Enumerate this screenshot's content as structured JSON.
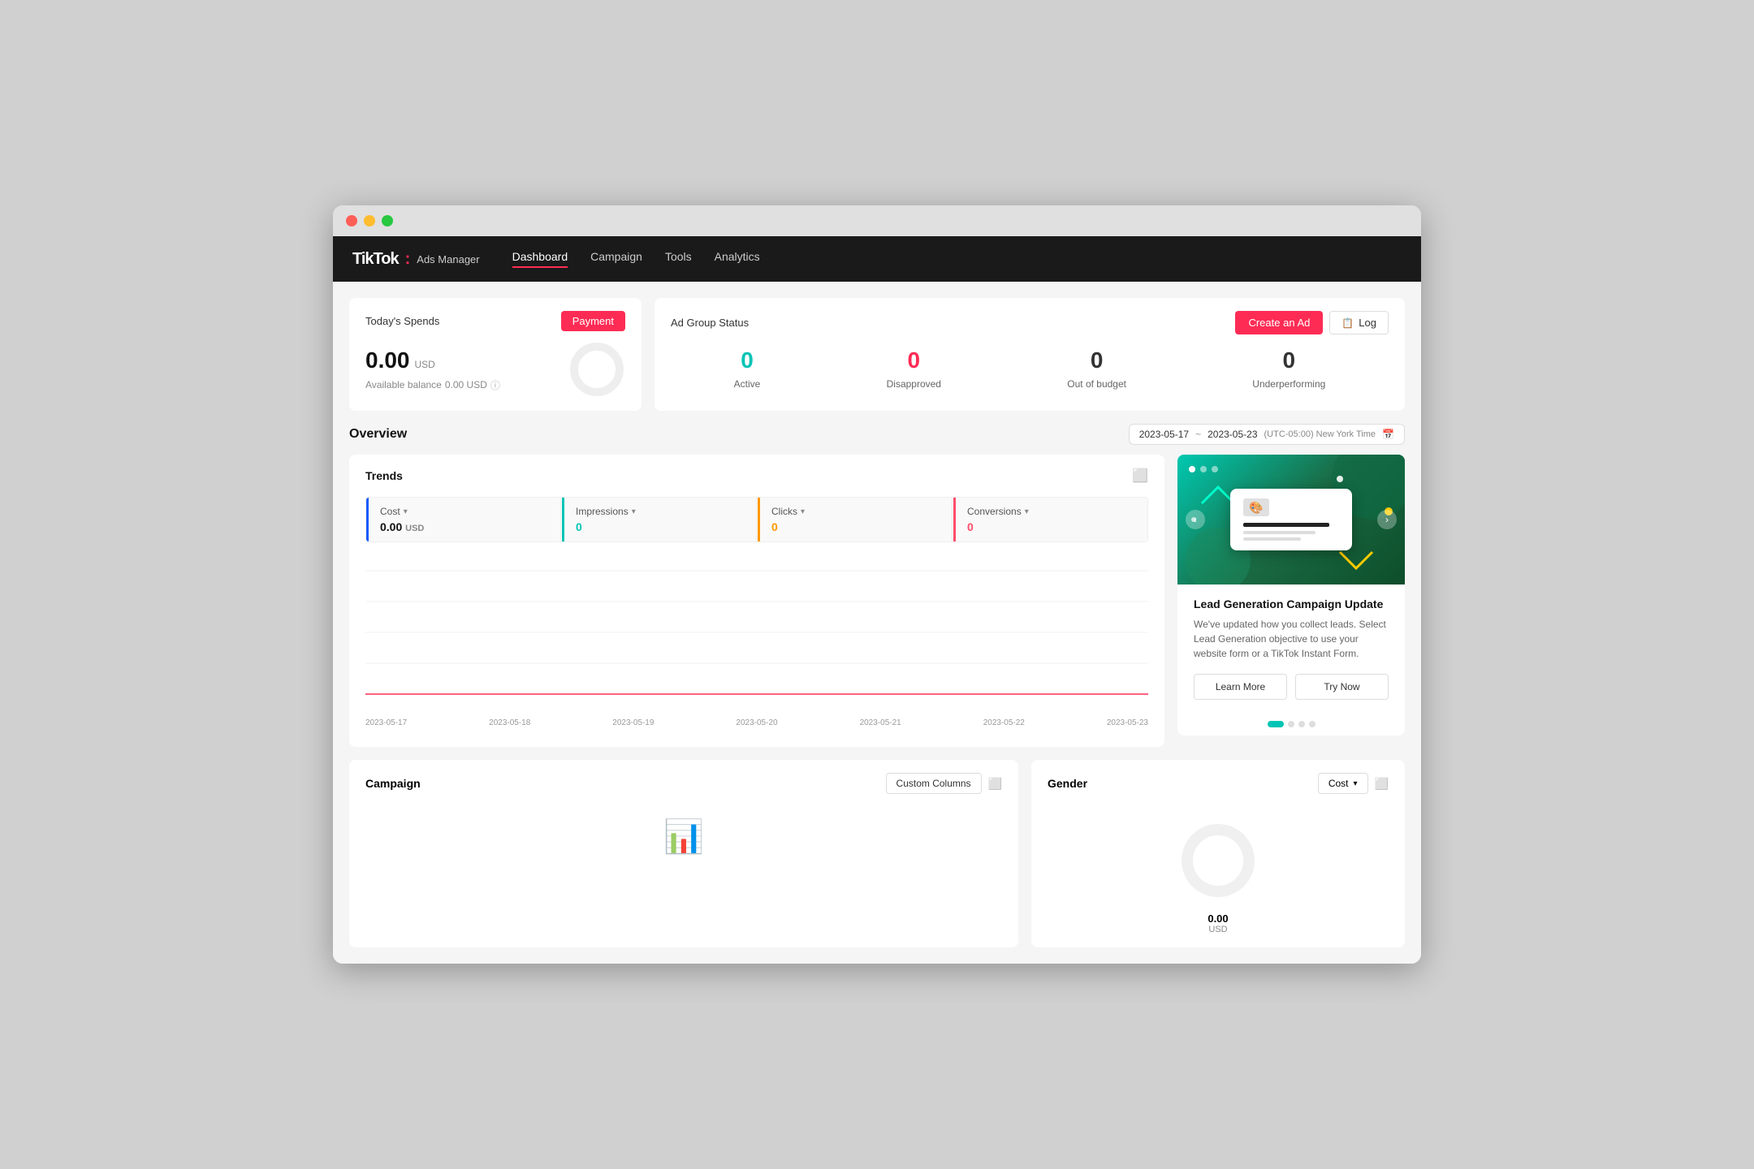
{
  "window": {
    "title": "TikTok Ads Manager"
  },
  "nav": {
    "brand": "TikTok",
    "brand_sub": "Ads Manager",
    "links": [
      {
        "label": "Dashboard",
        "active": true
      },
      {
        "label": "Campaign",
        "active": false
      },
      {
        "label": "Tools",
        "active": false
      },
      {
        "label": "Analytics",
        "active": false
      }
    ]
  },
  "spend_card": {
    "title": "Today's Spends",
    "payment_btn": "Payment",
    "amount": "0.00",
    "currency": "USD",
    "balance_label": "Available balance",
    "balance_value": "0.00 USD"
  },
  "status_card": {
    "title": "Ad Group Status",
    "create_ad_btn": "Create an Ad",
    "log_btn": "Log",
    "items": [
      {
        "label": "Active",
        "value": "0",
        "color": "teal"
      },
      {
        "label": "Disapproved",
        "value": "0",
        "color": "red"
      },
      {
        "label": "Out of budget",
        "value": "0",
        "color": "dark"
      },
      {
        "label": "Underperforming",
        "value": "0",
        "color": "dark"
      }
    ]
  },
  "overview": {
    "title": "Overview",
    "date_start": "2023-05-17",
    "date_end": "2023-05-23",
    "timezone": "(UTC-05:00) New York Time"
  },
  "trends": {
    "title": "Trends",
    "metrics": [
      {
        "label": "Cost",
        "value": "0.00",
        "unit": "USD",
        "color": "blue"
      },
      {
        "label": "Impressions",
        "value": "0",
        "color": "teal"
      },
      {
        "label": "Clicks",
        "value": "0",
        "color": "orange"
      },
      {
        "label": "Conversions",
        "value": "0",
        "color": "pink"
      }
    ],
    "x_labels": [
      "2023-05-17",
      "2023-05-18",
      "2023-05-19",
      "2023-05-20",
      "2023-05-21",
      "2023-05-22",
      "2023-05-23"
    ]
  },
  "promo": {
    "title": "Lead Generation Campaign Update",
    "description": "We've updated how you collect leads. Select Lead Generation objective to use your website form or a TikTok Instant Form.",
    "learn_more_btn": "Learn More",
    "try_now_btn": "Try Now",
    "carousel_dots": [
      {
        "active": true
      },
      {
        "active": false
      },
      {
        "active": false
      },
      {
        "active": false
      }
    ]
  },
  "campaign": {
    "title": "Campaign",
    "custom_columns_btn": "Custom Columns"
  },
  "gender": {
    "title": "Gender",
    "cost_label": "Cost",
    "cost_value": "0.00",
    "cost_currency": "USD",
    "dropdown": "Cost"
  }
}
